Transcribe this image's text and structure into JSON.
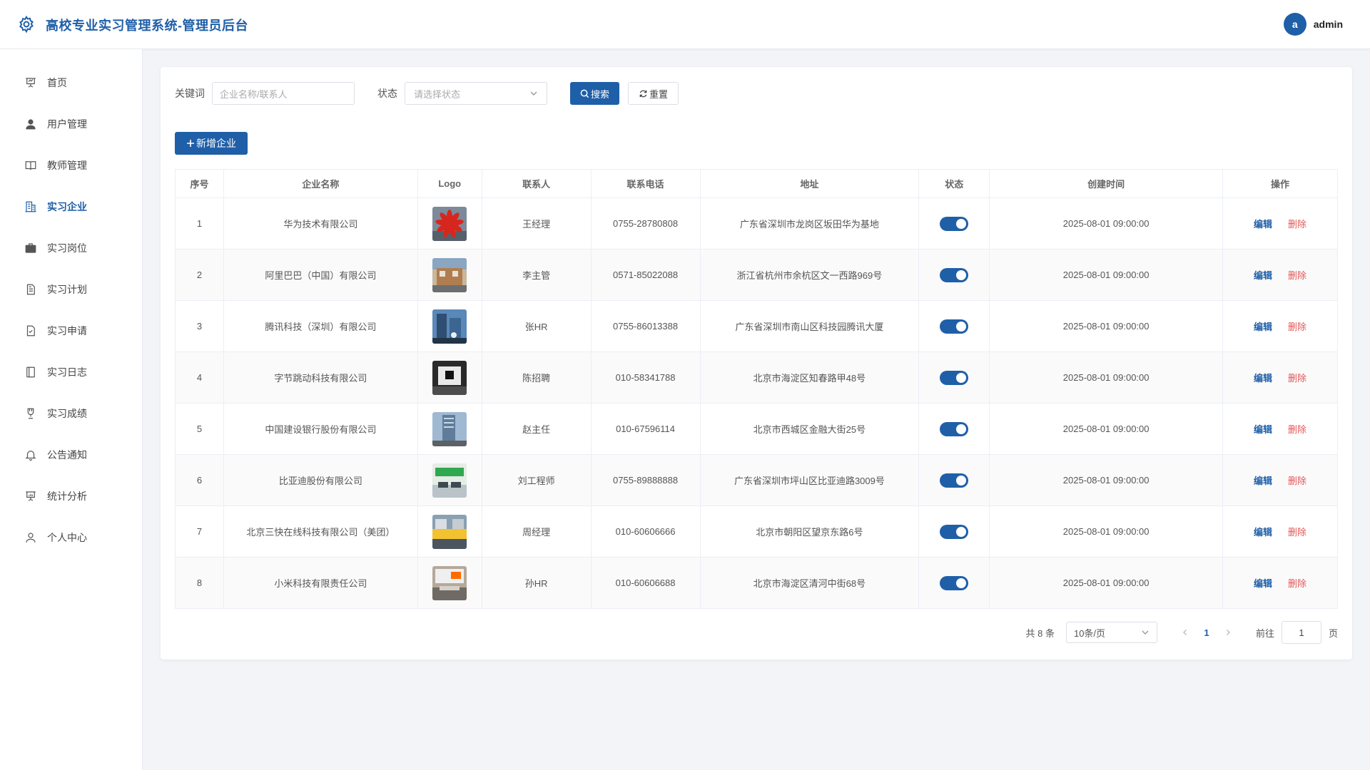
{
  "header": {
    "title": "高校专业实习管理系统-管理员后台",
    "avatar_letter": "a",
    "username": "admin"
  },
  "sidebar": {
    "items": [
      {
        "label": "首页",
        "icon": "presentation-icon"
      },
      {
        "label": "用户管理",
        "icon": "user-icon"
      },
      {
        "label": "教师管理",
        "icon": "book-icon"
      },
      {
        "label": "实习企业",
        "icon": "building-icon",
        "active": true
      },
      {
        "label": "实习岗位",
        "icon": "briefcase-icon"
      },
      {
        "label": "实习计划",
        "icon": "document-icon"
      },
      {
        "label": "实习申请",
        "icon": "document-check-icon"
      },
      {
        "label": "实习日志",
        "icon": "notebook-icon"
      },
      {
        "label": "实习成绩",
        "icon": "trophy-icon"
      },
      {
        "label": "公告通知",
        "icon": "bell-icon"
      },
      {
        "label": "统计分析",
        "icon": "data-board-icon"
      },
      {
        "label": "个人中心",
        "icon": "user-outline-icon"
      }
    ]
  },
  "filter": {
    "keyword_label": "关键词",
    "keyword_placeholder": "企业名称/联系人",
    "status_label": "状态",
    "status_placeholder": "请选择状态",
    "search_label": "搜索",
    "reset_label": "重置"
  },
  "add_button": "新增企业",
  "table": {
    "headers": [
      "序号",
      "企业名称",
      "Logo",
      "联系人",
      "联系电话",
      "地址",
      "状态",
      "创建时间",
      "操作"
    ],
    "edit_label": "编辑",
    "delete_label": "删除",
    "rows": [
      {
        "no": "1",
        "name": "华为技术有限公司",
        "contact": "王经理",
        "phone": "0755-28780808",
        "address": "广东省深圳市龙岗区坂田华为基地",
        "status": true,
        "created": "2025-08-01 09:00:00"
      },
      {
        "no": "2",
        "name": "阿里巴巴（中国）有限公司",
        "contact": "李主管",
        "phone": "0571-85022088",
        "address": "浙江省杭州市余杭区文一西路969号",
        "status": true,
        "created": "2025-08-01 09:00:00"
      },
      {
        "no": "3",
        "name": "腾讯科技（深圳）有限公司",
        "contact": "张HR",
        "phone": "0755-86013388",
        "address": "广东省深圳市南山区科技园腾讯大厦",
        "status": true,
        "created": "2025-08-01 09:00:00"
      },
      {
        "no": "4",
        "name": "字节跳动科技有限公司",
        "contact": "陈招聘",
        "phone": "010-58341788",
        "address": "北京市海淀区知春路甲48号",
        "status": true,
        "created": "2025-08-01 09:00:00"
      },
      {
        "no": "5",
        "name": "中国建设银行股份有限公司",
        "contact": "赵主任",
        "phone": "010-67596114",
        "address": "北京市西城区金融大街25号",
        "status": true,
        "created": "2025-08-01 09:00:00"
      },
      {
        "no": "6",
        "name": "比亚迪股份有限公司",
        "contact": "刘工程师",
        "phone": "0755-89888888",
        "address": "广东省深圳市坪山区比亚迪路3009号",
        "status": true,
        "created": "2025-08-01 09:00:00"
      },
      {
        "no": "7",
        "name": "北京三快在线科技有限公司（美团）",
        "contact": "周经理",
        "phone": "010-60606666",
        "address": "北京市朝阳区望京东路6号",
        "status": true,
        "created": "2025-08-01 09:00:00"
      },
      {
        "no": "8",
        "name": "小米科技有限责任公司",
        "contact": "孙HR",
        "phone": "010-60606688",
        "address": "北京市海淀区清河中街68号",
        "status": true,
        "created": "2025-08-01 09:00:00"
      }
    ]
  },
  "pagination": {
    "total_text": "共 8 条",
    "page_size": "10条/页",
    "current_page": "1",
    "goto_label": "前往",
    "goto_value": "1",
    "page_suffix": "页"
  },
  "colors": {
    "primary": "#1f5fa8",
    "danger": "#e45656"
  }
}
